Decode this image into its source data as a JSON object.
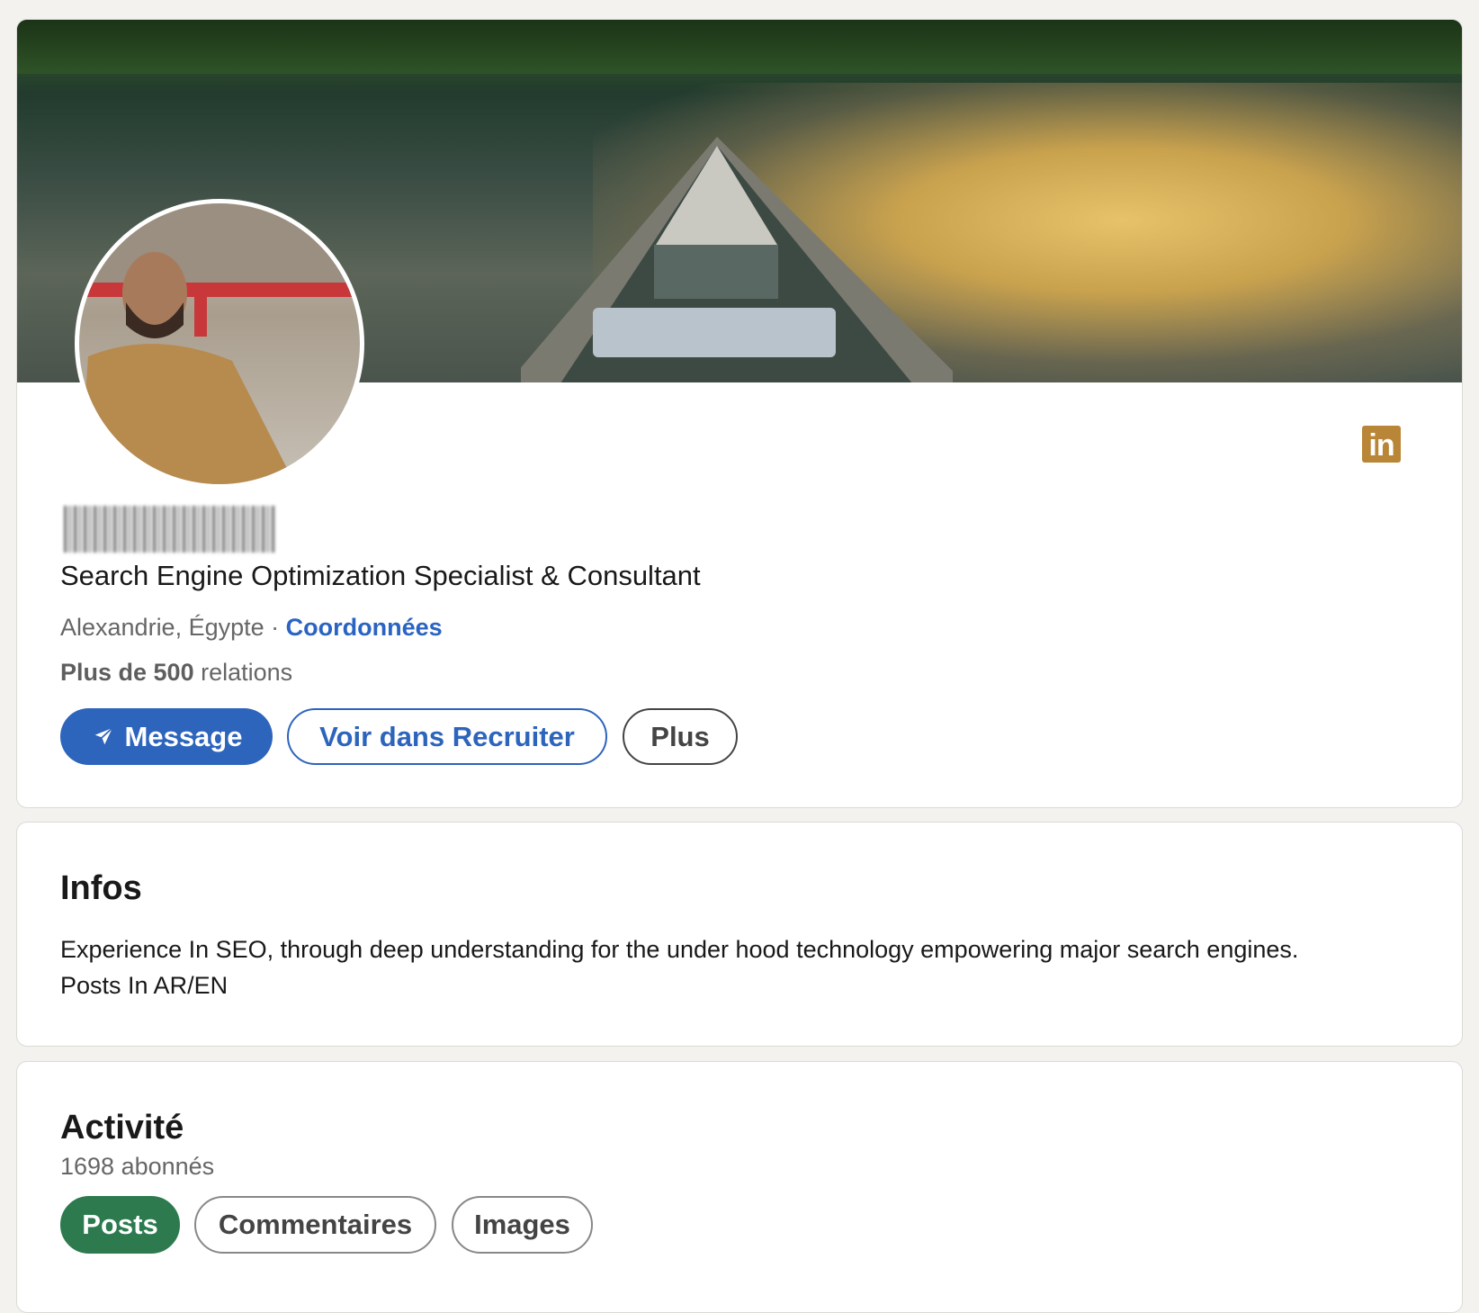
{
  "profile": {
    "headline": "Search Engine Optimization Specialist & Consultant",
    "location": "Alexandrie, Égypte",
    "separator": " · ",
    "contact_link": "Coordonnées",
    "relations_bold": "Plus de 500",
    "relations_rest": " relations",
    "linkedin_icon": "in"
  },
  "actions": {
    "message": "Message",
    "recruiter": "Voir dans Recruiter",
    "more": "Plus"
  },
  "about": {
    "title": "Infos",
    "line1": "Experience In SEO, through deep understanding for the under hood technology empowering major search engines.",
    "line2": "Posts In AR/EN"
  },
  "activity": {
    "title": "Activité",
    "followers": "1698 abonnés",
    "tabs": [
      "Posts",
      "Commentaires",
      "Images"
    ]
  },
  "colors": {
    "primary": "#2d64bc",
    "active_tab": "#2d7a4f",
    "linkedin_badge": "#b98536"
  }
}
